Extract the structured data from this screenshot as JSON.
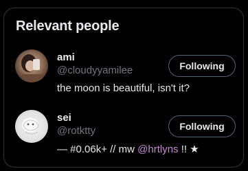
{
  "panel": {
    "title": "Relevant people"
  },
  "people": [
    {
      "name": "ami",
      "handle": "@cloudyyamilee",
      "bio": "the moon is beautiful, isn't it?",
      "follow_label": "Following",
      "avatar_icon": "user-avatar-photo"
    },
    {
      "name": "sei",
      "handle": "@rotktty",
      "bio_before": "— #0.06k+ // mw ",
      "bio_mention": "@hrtlyns",
      "bio_after": " !! ★",
      "follow_label": "Following",
      "avatar_icon": "user-avatar-photo"
    }
  ],
  "colors": {
    "background": "#000000",
    "border": "#2f3336",
    "primary_text": "#e7e9ea",
    "secondary_text": "#71767b",
    "mention": "#c58ad6"
  }
}
